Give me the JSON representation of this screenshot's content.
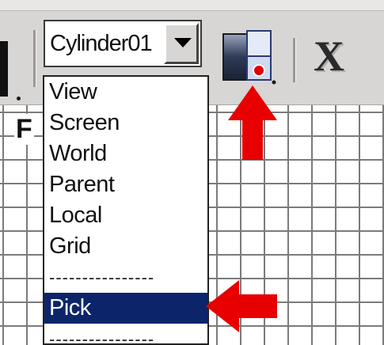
{
  "toolbar": {
    "reference_coordinate_value": "Cylinder01",
    "pivot_icon": "use-pivot-point-center-icon",
    "close_glyph": "X"
  },
  "viewport": {
    "label_visible": "F"
  },
  "dropdown": {
    "options": [
      "View",
      "Screen",
      "World",
      "Parent",
      "Local",
      "Grid",
      "----------------",
      "Pick",
      "----------------"
    ],
    "selected": "Pick"
  },
  "annotations": {
    "arrow_color": "#e80000",
    "selection_color": "#0c246a"
  }
}
